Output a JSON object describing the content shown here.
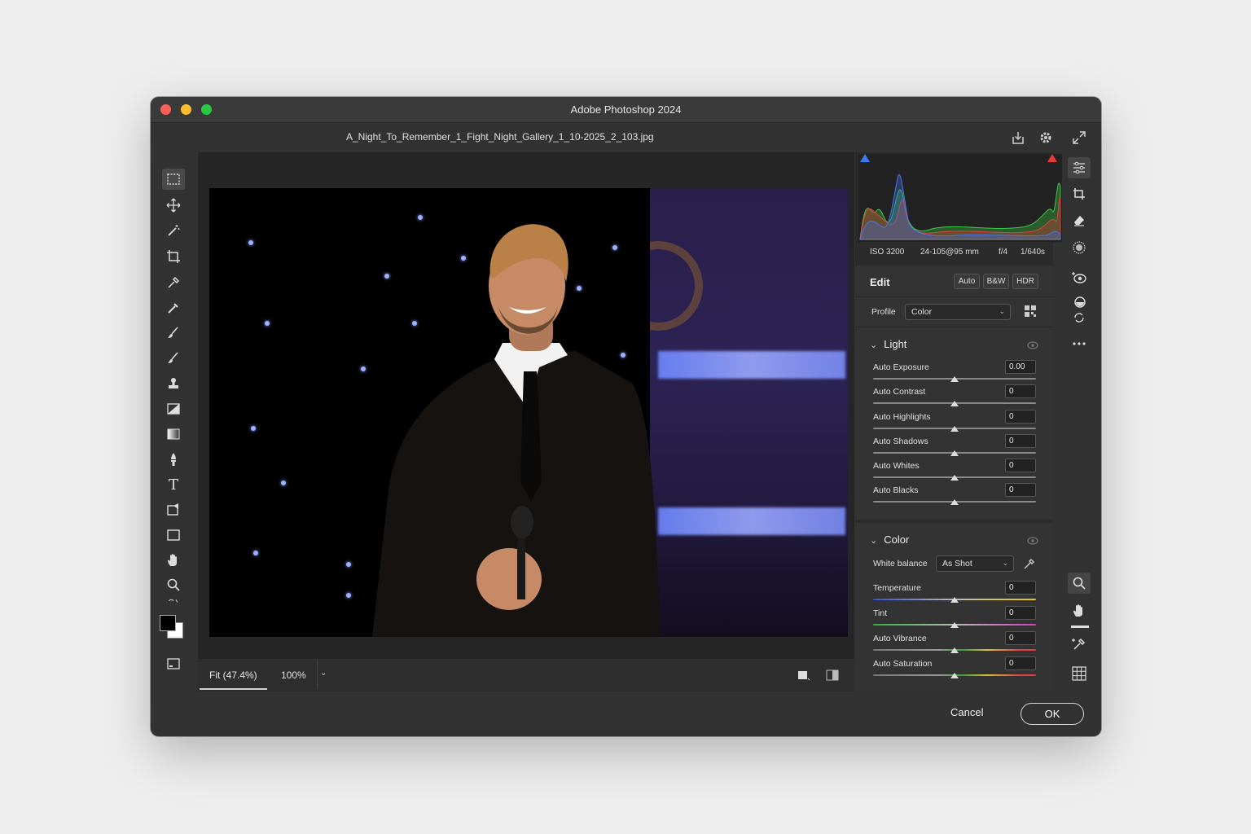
{
  "window": {
    "app_title": "Adobe Photoshop 2024",
    "document_name": "A_Night_To_Remember_1_Fight_Night_Gallery_1_10-2025_2_103.jpg"
  },
  "zoom": {
    "fit_label": "Fit (47.4%)",
    "percent_label": "100%"
  },
  "camera_info": {
    "iso": "ISO 3200",
    "lens": "24-105@95 mm",
    "aperture": "f/4",
    "shutter": "1/640s"
  },
  "edit": {
    "title": "Edit",
    "auto_label": "Auto",
    "bw_label": "B&W",
    "hdr_label": "HDR",
    "profile_label": "Profile",
    "profile_value": "Color"
  },
  "light": {
    "title": "Light",
    "sliders": [
      {
        "label": "Auto Exposure",
        "value": "0.00"
      },
      {
        "label": "Auto Contrast",
        "value": "0"
      },
      {
        "label": "Auto Highlights",
        "value": "0"
      },
      {
        "label": "Auto Shadows",
        "value": "0"
      },
      {
        "label": "Auto Whites",
        "value": "0"
      },
      {
        "label": "Auto Blacks",
        "value": "0"
      }
    ]
  },
  "color": {
    "title": "Color",
    "white_balance_label": "White balance",
    "white_balance_value": "As Shot",
    "sliders": [
      {
        "label": "Temperature",
        "value": "0"
      },
      {
        "label": "Tint",
        "value": "0"
      },
      {
        "label": "Auto Vibrance",
        "value": "0"
      },
      {
        "label": "Auto Saturation",
        "value": "0"
      }
    ]
  },
  "footer": {
    "cancel_label": "Cancel",
    "ok_label": "OK"
  },
  "colors": {
    "window_bg": "#323232",
    "panel_bg": "#2b2b2b",
    "section_bg": "#333333"
  }
}
